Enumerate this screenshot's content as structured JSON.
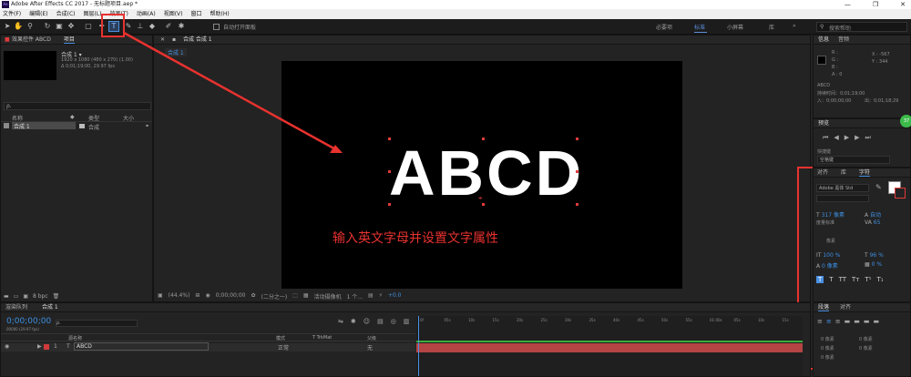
{
  "window": {
    "title": "Adobe After Effects CC 2017 - 无标题项目.aep *",
    "app_icon": "Ae",
    "controls": [
      "—",
      "❐",
      "✕"
    ]
  },
  "menu": [
    "文件(F)",
    "编辑(E)",
    "合成(C)",
    "图层(L)",
    "效果(T)",
    "动画(A)",
    "视图(V)",
    "窗口",
    "帮助(H)"
  ],
  "toolbar": {
    "auto_open_label": "自动打开面板",
    "workspaces": [
      "必要项",
      "标准",
      "小屏幕",
      "库"
    ],
    "active_workspace": "标准",
    "more": "»",
    "search_placeholder": "搜索帮助"
  },
  "project_panel": {
    "effects_tab": "效果控件 ABCD",
    "project_tab": "项目",
    "comp_name": "合成 1 ▾",
    "comp_info_1": "1920 x 1080 (480 x 270) (1.00)",
    "comp_info_2": "Δ 0;01;19;00, 29.97 fps",
    "search_placeholder": "ρ.",
    "col_name": "名称",
    "col_type": "类型",
    "col_size": "大小",
    "item_name": "合成 1",
    "item_type": "合成",
    "bpc": "8 bpc"
  },
  "composition": {
    "tab_label": "合成 合成 1",
    "flow_label": "合成 1",
    "text": "ABCD",
    "zoom": "(44.4%)",
    "timecode": "0;00;00;00",
    "resolution": "(二分之一)",
    "camera": "活动摄像机",
    "views": "1 个...",
    "exposure": "+0.0"
  },
  "annotation": {
    "text": "输入英文字母并设置文字属性",
    "color": "#e8322f"
  },
  "info_panel": {
    "tab_info": "信息",
    "tab_audio": "音频",
    "r": "R :",
    "g": "G :",
    "b": "B :",
    "a": "A : 0",
    "x": "X : -567",
    "y": "Y : 344",
    "layer_name": "ABCD",
    "duration": "持续时间：0;01;19;00",
    "in_point": "入：0;00;00;00",
    "out_point": "出：0;01;18;29"
  },
  "preview_panel": {
    "title": "预览",
    "shortcut_label": "快捷键",
    "shortcut_value": "空格键"
  },
  "character_panel": {
    "tabs": [
      "对齐",
      "库",
      "字符"
    ],
    "font": "Adobe 黑体 Std",
    "size": "317 像素",
    "leading": "自动",
    "kerning_label": "度量标准",
    "tracking": "65",
    "stroke_label": "像素",
    "vscale": "100 %",
    "hscale": "96 %",
    "baseline": "0 像素",
    "tsume": "0 %",
    "style_buttons": [
      "T",
      "T",
      "TT",
      "Tт",
      "T¹",
      "T₁"
    ]
  },
  "paragraph_panel": {
    "tabs": [
      "段落",
      "对齐"
    ],
    "indent_values": [
      "0 像素",
      "0 像素",
      "0 像素",
      "0 像素",
      "0 像素"
    ]
  },
  "timeline": {
    "tab_render": "渲染队列",
    "tab_comp": "合成 1",
    "timecode": "0;00;00;00",
    "timecode_sub": "00000 (29.97 fps)",
    "col_source": "源名称",
    "col_mode": "模式",
    "col_trkmat": "T  TrkMat",
    "col_parent": "父级",
    "layer_num": "1",
    "layer_name": "ABCD",
    "layer_mode": "正常",
    "layer_parent": "无",
    "ruler": [
      "0f",
      "05s",
      "10s",
      "15s",
      "20s",
      "25s",
      "30s",
      "35s",
      "40s",
      "45s",
      "50s",
      "55s",
      "01:00s",
      "05s",
      "10s",
      "15s"
    ]
  },
  "percent_badge": "37"
}
